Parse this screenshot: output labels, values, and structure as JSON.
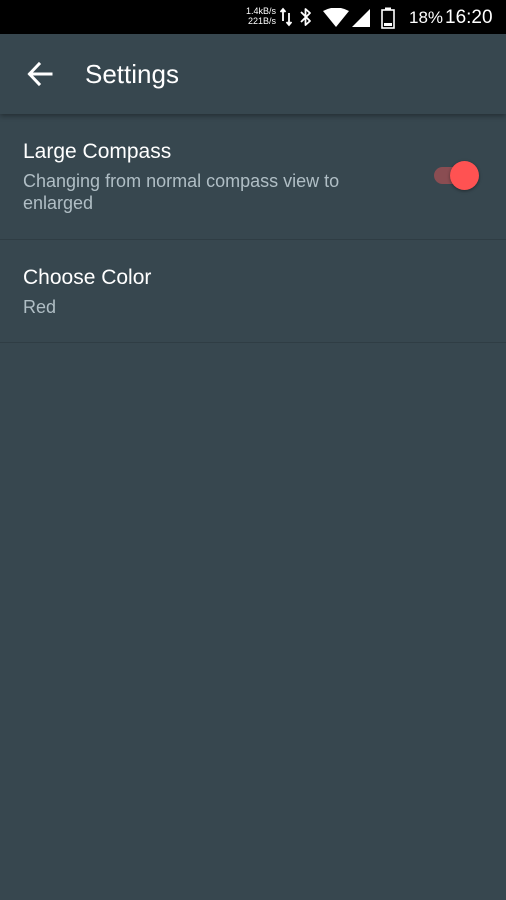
{
  "status_bar": {
    "net_speed_up": "1.4kB/s",
    "net_speed_down": "221B/s",
    "battery_percent": "18%",
    "time": "16:20",
    "icons": [
      "data-transfer-icon",
      "bluetooth-icon",
      "wifi-icon",
      "cell-signal-icon",
      "battery-icon"
    ]
  },
  "app_bar": {
    "title": "Settings",
    "back_icon": "arrow-back-icon"
  },
  "settings": {
    "large_compass": {
      "title": "Large Compass",
      "summary": "Changing from normal compass view to enlarged",
      "enabled": true
    },
    "choose_color": {
      "title": "Choose Color",
      "value": "Red"
    }
  },
  "colors": {
    "background": "#37474f",
    "accent": "#ff5252",
    "summary_text": "#b0bec5"
  }
}
